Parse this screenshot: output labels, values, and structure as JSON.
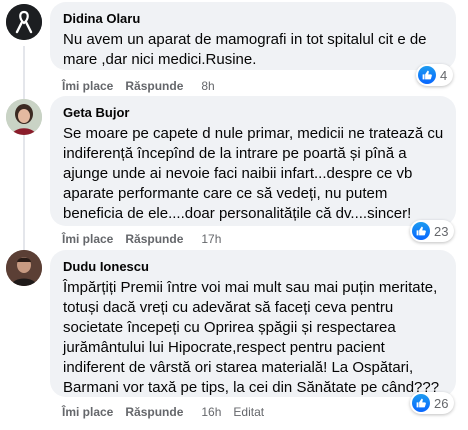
{
  "comments": [
    {
      "author": "Didina Olaru",
      "text": "Nu avem un aparat de mamografi in tot spitalul cit e de mare ,dar nici medici.Rusine.",
      "like_label": "Îmi place",
      "reply_label": "Răspunde",
      "time": "8h",
      "reaction_count": "4",
      "avatar_icon": "black-ribbon-avatar-icon"
    },
    {
      "author": "Geta Bujor",
      "text": "Se moare pe capete d nule primar, medicii ne tratează cu indiferență începînd de la intrare pe poartă și pînă a ajunge unde ai nevoie faci naibii infart...despre ce vb aparate performante care ce să vedeți, nu putem beneficia de ele....doar personalitățile că dv....sincer!",
      "like_label": "Îmi place",
      "reply_label": "Răspunde",
      "time": "17h",
      "reaction_count": "23",
      "avatar_icon": "woman-portrait-avatar-icon"
    },
    {
      "author": "Dudu Ionescu",
      "text": "Împărțiți Premii între voi mai mult sau mai puțin meritate, totuși dacă vreți cu adevărat să faceți ceva pentru societate începeți cu Oprirea șpăgii și respectarea jurământului lui Hipocrate,respect pentru pacient indiferent de vârstă ori starea materială! La Ospătari, Barmani vor taxă pe tips, la cei din Sănătate pe când???",
      "like_label": "Îmi place",
      "reply_label": "Răspunde",
      "time": "16h",
      "edited_label": "Editat",
      "reaction_count": "26",
      "avatar_icon": "man-portrait-avatar-icon"
    }
  ],
  "colors": {
    "bubble": "#f0f2f5",
    "meta_text": "#65676b",
    "like_blue": "#0866ff"
  }
}
